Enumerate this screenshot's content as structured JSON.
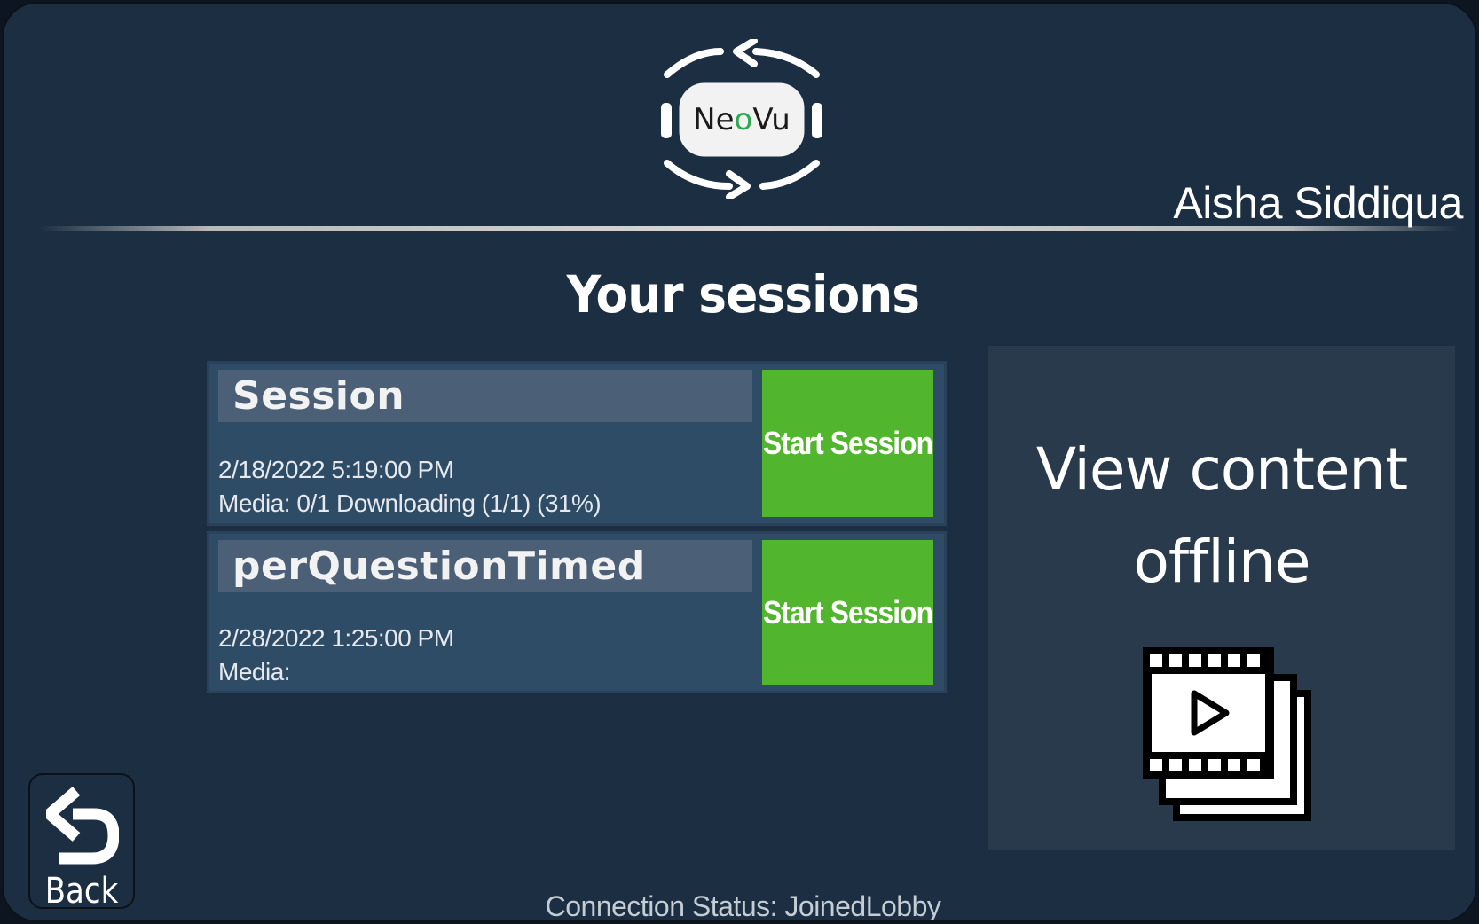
{
  "app": {
    "logo_text": "NeoVu"
  },
  "header": {
    "user_name": "Aisha Siddiqua"
  },
  "main": {
    "title": "Your sessions",
    "sessions": [
      {
        "name": "Session",
        "date": "2/18/2022 5:19:00 PM",
        "media": "Media: 0/1 Downloading (1/1) (31%)",
        "button_label": "Start Session"
      },
      {
        "name": "perQuestionTimed",
        "date": "2/28/2022 1:25:00 PM",
        "media": "Media:",
        "button_label": "Start Session"
      }
    ],
    "offline": {
      "label": "View content offline",
      "icon": "film-stack-play-icon"
    }
  },
  "footer": {
    "back_label": "Back",
    "back_icon": "undo-arrow-icon",
    "connection_status": "Connection Status: JoinedLobby"
  },
  "colors": {
    "background": "#1c2e41",
    "card": "#2f4c66",
    "name_bar": "#4b5f76",
    "start_button": "#52b52e",
    "offline_panel": "#283a4b",
    "logo_dot": "#2fa84f"
  }
}
